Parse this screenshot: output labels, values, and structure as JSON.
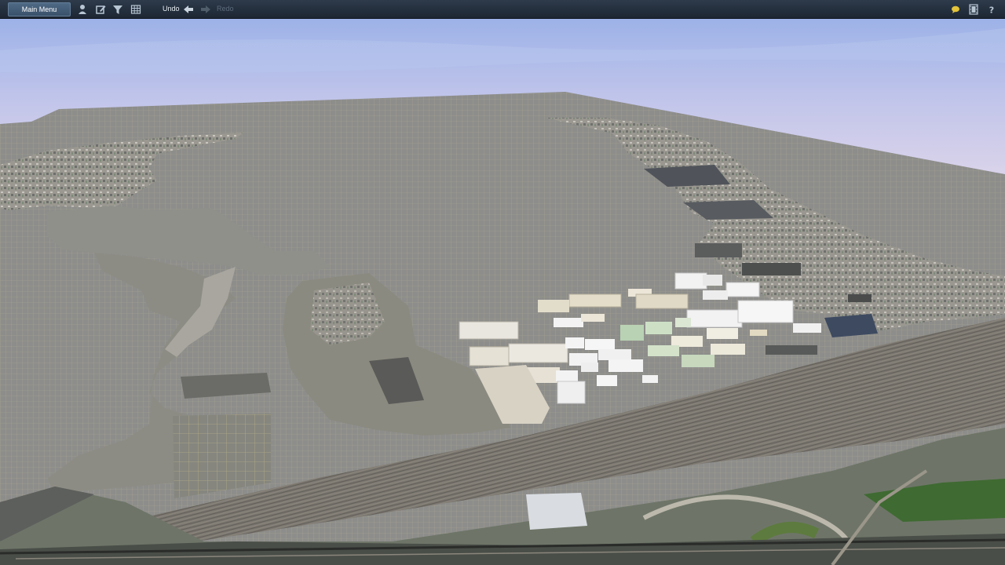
{
  "toolbar": {
    "main_menu_label": "Main Menu",
    "undo_label": "Undo",
    "redo_label": "Redo",
    "icons": [
      "person-icon",
      "edit-icon",
      "filter-icon",
      "grid-icon",
      "undo-arrow-icon",
      "redo-arrow-icon",
      "chat-bubble-icon",
      "film-icon",
      "help-icon"
    ],
    "colors": {
      "bar": "#243040",
      "button": "#45607c",
      "text": "#e8eef4",
      "disabled": "#5d6b7a",
      "chat_icon": "#e3c43a"
    }
  },
  "scene": {
    "description_colors": {
      "sky_top": "#9db2e8",
      "sky_bottom": "#d6d2ea",
      "grid_ground": "#8f8f8f",
      "grid_lines": "#b5b09a"
    }
  }
}
